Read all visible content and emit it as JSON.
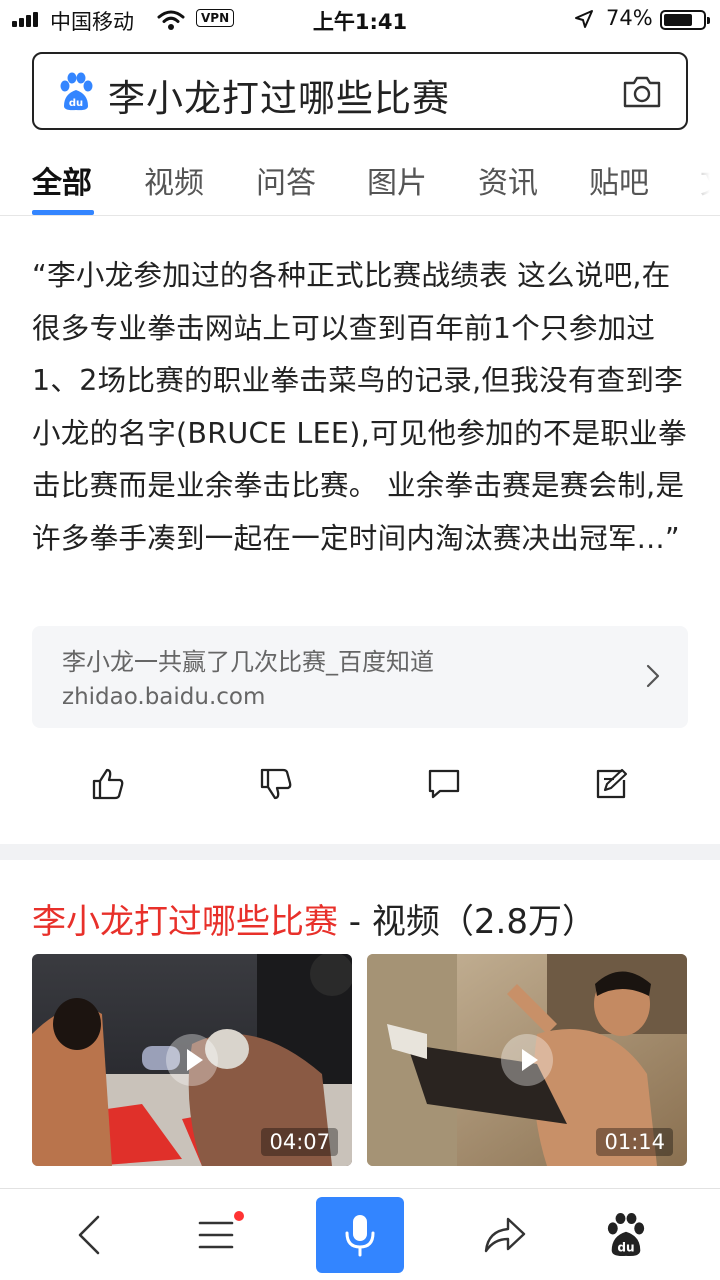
{
  "status_bar": {
    "carrier": "中国移动",
    "vpn": "VPN",
    "time": "上午1:41",
    "battery": "74%",
    "battery_level": 0.74
  },
  "search": {
    "query": "李小龙打过哪些比赛",
    "logo_icon": "baidu-paw-icon",
    "camera_icon": "camera-icon"
  },
  "tabs": [
    {
      "label": "全部",
      "active": true
    },
    {
      "label": "视频"
    },
    {
      "label": "问答"
    },
    {
      "label": "图片"
    },
    {
      "label": "资讯"
    },
    {
      "label": "贴吧"
    },
    {
      "label": "文"
    }
  ],
  "answer": {
    "text": "“李小龙参加过的各种正式比赛战绩表 这么说吧,在很多专业拳击网站上可以查到百年前1个只参加过1、2场比赛的职业拳击菜鸟的记录,但我没有查到李小龙的名字(BRUCE LEE),可见他参加的不是职业拳击比赛而是业余拳击比赛。 业余拳击赛是赛会制,是许多拳手凑到一起在一定时间内淘汰赛决出冠军...”",
    "source_title": "李小龙一共赢了几次比赛_百度知道",
    "source_url": "zhidao.baidu.com",
    "actions": [
      "thumbs-up-icon",
      "thumbs-down-icon",
      "comment-icon",
      "edit-icon"
    ]
  },
  "videos": {
    "title_highlight": "李小龙打过哪些比赛",
    "title_rest": " - 视频（2.8万）",
    "items": [
      {
        "duration": "04:07"
      },
      {
        "duration": "01:14"
      }
    ]
  },
  "bottom_bar": {
    "icons": [
      "back-icon",
      "menu-icon",
      "mic-icon",
      "share-icon",
      "baidu-paw-icon"
    ],
    "accent": "#3385ff"
  }
}
